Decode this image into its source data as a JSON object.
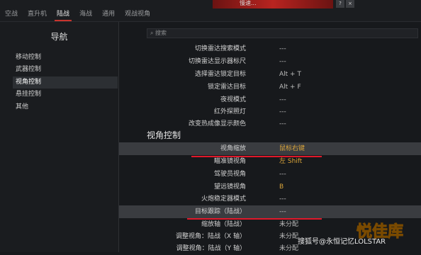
{
  "tabs": [
    {
      "label": "空战"
    },
    {
      "label": "直升机"
    },
    {
      "label": "陆战"
    },
    {
      "label": "海战"
    },
    {
      "label": "通用"
    },
    {
      "label": "观战视角"
    }
  ],
  "banner": {
    "text": "慢速...",
    "btn_a": "?",
    "btn_b": "×"
  },
  "nav": {
    "title": "导航",
    "items": [
      {
        "label": "移动控制"
      },
      {
        "label": "武器控制"
      },
      {
        "label": "视角控制"
      },
      {
        "label": "悬挂控制"
      },
      {
        "label": "其他"
      }
    ]
  },
  "search": {
    "placeholder": "搜索"
  },
  "rows_top": [
    {
      "label": "切换雷达搜索模式",
      "value": "---"
    },
    {
      "label": "切换雷达显示器标尺",
      "value": "---"
    },
    {
      "label": "选择雷达锁定目标",
      "value": "Alt + T"
    },
    {
      "label": "锁定雷达目标",
      "value": "Alt + F"
    },
    {
      "label": "夜视模式",
      "value": "---"
    },
    {
      "label": "红外探照灯",
      "value": "---"
    },
    {
      "label": "改变热成像显示颜色",
      "value": "---"
    }
  ],
  "section_title": "视角控制",
  "rows_bottom": [
    {
      "label": "视角缩放",
      "value": "鼠标右键"
    },
    {
      "label": "瞄准镜视角",
      "value": "左 Shift"
    },
    {
      "label": "驾驶员视角",
      "value": "---"
    },
    {
      "label": "望远镜视角",
      "value": "B"
    },
    {
      "label": "火炮稳定器模式",
      "value": "---"
    },
    {
      "label": "目标跟踪（陆战）",
      "value": "---"
    },
    {
      "label": "缩放轴（陆战）",
      "value": "未分配"
    },
    {
      "label": "调整视角：陆战（X 轴）",
      "value": "未分配"
    },
    {
      "label": "调整视角：陆战（Y 轴）",
      "value": "未分配"
    }
  ],
  "watermark": "搜狐号@永恒记忆LOLSTAR",
  "corner_logo": "悦佳库",
  "colors": {
    "accent_red": "#e0182a",
    "gold": "#d9a43a"
  }
}
